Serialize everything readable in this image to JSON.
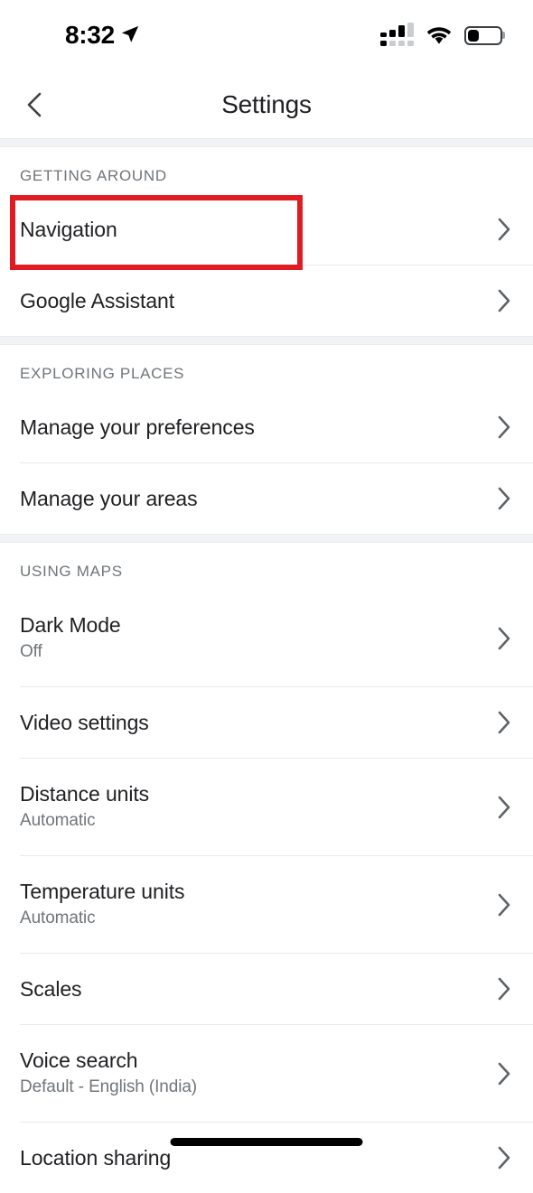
{
  "status_bar": {
    "time": "8:32",
    "icons": {
      "location_arrow": "location-arrow-icon",
      "cellular": "cellular-signal-icon",
      "wifi": "wifi-icon",
      "battery": "battery-low-icon"
    }
  },
  "app_bar": {
    "back_icon": "back-chevron-icon",
    "title": "Settings"
  },
  "highlight": {
    "target": "Navigation",
    "color": "#e01b22"
  },
  "sections": [
    {
      "header": "GETTING AROUND",
      "rows": [
        {
          "title": "Navigation",
          "subtitle": "",
          "chevron": "chevron-right-icon"
        },
        {
          "title": "Google Assistant",
          "subtitle": "",
          "chevron": "chevron-right-icon"
        }
      ]
    },
    {
      "header": "EXPLORING PLACES",
      "rows": [
        {
          "title": "Manage your preferences",
          "subtitle": "",
          "chevron": "chevron-right-icon"
        },
        {
          "title": "Manage your areas",
          "subtitle": "",
          "chevron": "chevron-right-icon"
        }
      ]
    },
    {
      "header": "USING MAPS",
      "rows": [
        {
          "title": "Dark Mode",
          "subtitle": "Off",
          "chevron": "chevron-right-icon"
        },
        {
          "title": "Video settings",
          "subtitle": "",
          "chevron": "chevron-right-icon"
        },
        {
          "title": "Distance units",
          "subtitle": "Automatic",
          "chevron": "chevron-right-icon"
        },
        {
          "title": "Temperature units",
          "subtitle": "Automatic",
          "chevron": "chevron-right-icon"
        },
        {
          "title": "Scales",
          "subtitle": "",
          "chevron": "chevron-right-icon"
        },
        {
          "title": "Voice search",
          "subtitle": "Default - English (India)",
          "chevron": "chevron-right-icon"
        },
        {
          "title": "Location sharing",
          "subtitle": "",
          "chevron": "chevron-right-icon"
        }
      ]
    }
  ],
  "home_indicator": "home-indicator"
}
